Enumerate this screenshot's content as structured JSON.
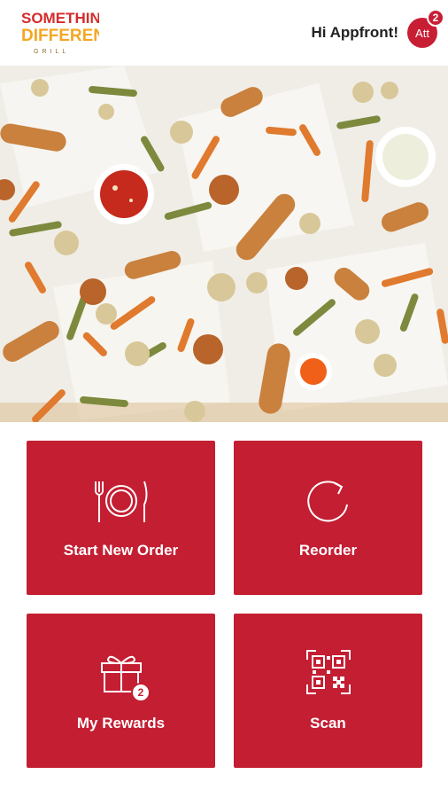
{
  "brand": {
    "line1": "SOMETHING",
    "line2": "DIFFERENT",
    "line3": "GRILL"
  },
  "header": {
    "greeting": "Hi Appfront!",
    "avatar_text": "Att",
    "notification_count": "2"
  },
  "tiles": [
    {
      "label": "Start New Order",
      "icon": "plate-cutlery-icon"
    },
    {
      "label": "Reorder",
      "icon": "reorder-icon"
    },
    {
      "label": "My Rewards",
      "icon": "gift-icon",
      "badge": "2"
    },
    {
      "label": "Scan",
      "icon": "qr-code-icon"
    }
  ],
  "colors": {
    "brand_red": "#c41e33",
    "logo_orange": "#f5a623",
    "logo_red": "#d62b2b"
  }
}
